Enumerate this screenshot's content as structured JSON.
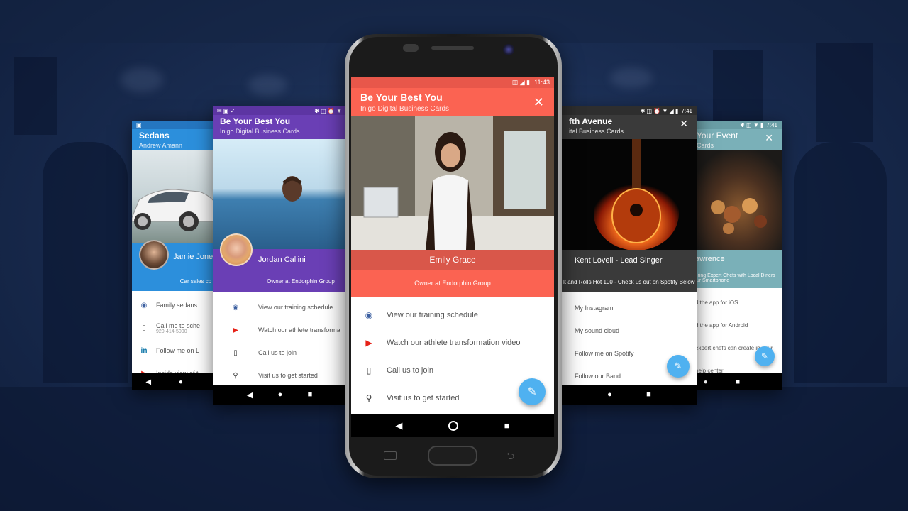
{
  "colors": {
    "main_accent": "#fb6352",
    "purple": "#6a3fb5",
    "blue": "#2c8fdc",
    "dark": "#3a3a3a",
    "teal": "#7ab0b8",
    "fab": "#4fb1f0"
  },
  "main": {
    "time": "11:43",
    "title": "Be Your Best You",
    "subtitle": "Inigo Digital Business Cards",
    "name": "Emily Grace",
    "role": "Owner at Endorphin Group",
    "items": [
      {
        "icon": "globe-icon",
        "label": "View our training schedule"
      },
      {
        "icon": "youtube-icon",
        "label": "Watch our athlete transformation video"
      },
      {
        "icon": "phone-icon",
        "label": "Call us to join"
      },
      {
        "icon": "location-pin-icon",
        "label": "Visit us to get started"
      }
    ]
  },
  "left1": {
    "title": "Be Your Best You",
    "subtitle": "Inigo Digital Business Cards",
    "name": "Jordan Callini",
    "role": "Owner at Endorphin Group",
    "items": [
      {
        "icon": "globe-icon",
        "label": "View our training schedule"
      },
      {
        "icon": "youtube-icon",
        "label": "Watch our athlete transforma"
      },
      {
        "icon": "phone-icon",
        "label": "Call us to join"
      },
      {
        "icon": "location-pin-icon",
        "label": "Visit us to get started"
      }
    ]
  },
  "left2": {
    "title": "Sedans",
    "subtitle": "Andrew Amann",
    "name": "Jamie Jones",
    "role": "Car sales co",
    "items": [
      {
        "icon": "globe-icon",
        "label": "Family sedans"
      },
      {
        "icon": "phone-icon",
        "label": "Call me to sche",
        "detail": "920-414-5000"
      },
      {
        "icon": "linkedin-icon",
        "label": "Follow me on L"
      },
      {
        "icon": "youtube-icon",
        "label": "Inside view of t"
      }
    ]
  },
  "right1": {
    "time": "7:41",
    "title": "fth Avenue",
    "subtitle": "ital Business Cards",
    "name": "Kent Lovell - Lead Singer",
    "role": "k and Rolls Hot 100 - Check us out on Spotify Below",
    "items": [
      {
        "label": "My Instagram"
      },
      {
        "label": "My sound cloud"
      },
      {
        "label": "Follow me on Spotify"
      },
      {
        "label": "Follow our Band"
      }
    ]
  },
  "right2": {
    "time": "7:41",
    "title": "Your Event",
    "subtitle": "Cards",
    "name": "awrence",
    "role_line1": "airing Expert Chefs with Local Diners",
    "role_line2": "our Smartphone",
    "items": [
      {
        "label": "d the app for iOS"
      },
      {
        "label": "d the app for Android"
      },
      {
        "label": "expert chefs can create in your"
      },
      {
        "label": "help center"
      }
    ]
  }
}
